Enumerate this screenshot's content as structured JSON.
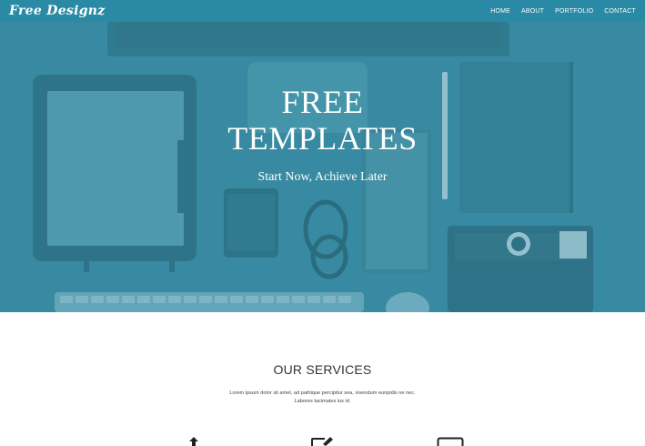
{
  "navbar": {
    "brand": "Free Designz",
    "items": [
      "HOME",
      "ABOUT",
      "PORTFOLIO",
      "CONTACT"
    ]
  },
  "hero": {
    "title_line1": "FREE",
    "title_line2": "TEMPLATES",
    "subtitle": "Start Now, Achieve Later"
  },
  "services": {
    "title": "OUR SERVICES",
    "desc_line1": "Lorem ipsum dolor sit amet, ad pathique percipitur sea, vivendum euripidis ne nec.",
    "desc_line2": "Labores tacimates ius id.",
    "icons": [
      "upload-icon",
      "edit-icon",
      "monitor-icon"
    ]
  },
  "colors": {
    "navbar": "#2a8aa5",
    "hero_tint": "#3f8fa3",
    "text_dark": "#333333"
  }
}
